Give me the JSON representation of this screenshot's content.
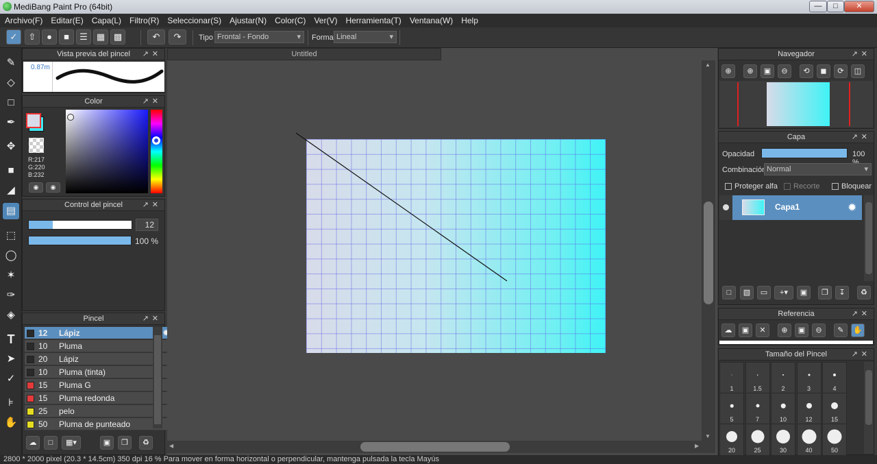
{
  "window": {
    "title": "MediBang Paint Pro (64bit)"
  },
  "menu": [
    "Archivo(F)",
    "Editar(E)",
    "Capa(L)",
    "Filtro(R)",
    "Seleccionar(S)",
    "Ajustar(N)",
    "Color(C)",
    "Ver(V)",
    "Herramienta(T)",
    "Ventana(W)",
    "Help"
  ],
  "toolbar": {
    "tipo_label": "Tipo",
    "tipo_value": "Frontal - Fondo",
    "forma_label": "Forma",
    "forma_value": "Lineal"
  },
  "brush_preview": {
    "title": "Vista previa del pincel",
    "size": "0.87m"
  },
  "color_panel": {
    "title": "Color",
    "r": "R:217",
    "g": "G:220",
    "b": "B:232",
    "fg": "#d9dce8",
    "bg": "#40e8f0"
  },
  "brush_control": {
    "title": "Control del pincel",
    "size": "12",
    "opacity": "100 %"
  },
  "brush_panel": {
    "title": "Pincel",
    "items": [
      {
        "size": "12",
        "name": "Lápiz",
        "color": "#2a2a2a",
        "selected": true
      },
      {
        "size": "10",
        "name": "Pluma",
        "color": "#2a2a2a"
      },
      {
        "size": "20",
        "name": "Lápiz",
        "color": "#2a2a2a"
      },
      {
        "size": "10",
        "name": "Pluma (tinta)",
        "color": "#2a2a2a"
      },
      {
        "size": "15",
        "name": "Pluma G",
        "color": "#e33b3b"
      },
      {
        "size": "15",
        "name": "Pluma redonda",
        "color": "#e33b3b"
      },
      {
        "size": "25",
        "name": "pelo",
        "color": "#e6dd22"
      },
      {
        "size": "50",
        "name": "Pluma de punteado",
        "color": "#e6dd22"
      }
    ]
  },
  "document": {
    "tab": "Untitled"
  },
  "navigator": {
    "title": "Navegador"
  },
  "layer_panel": {
    "title": "Capa",
    "opacity_label": "Opacidad",
    "opacity_value": "100 %",
    "blend_label": "Combinación",
    "blend_value": "Normal",
    "protect_alpha": "Proteger alfa",
    "clip": "Recorte",
    "lock": "Bloquear",
    "layer_name": "Capa1"
  },
  "reference": {
    "title": "Referencia"
  },
  "brush_size_panel": {
    "title": "Tamaño del Pincel",
    "sizes": [
      "1",
      "1.5",
      "2",
      "3",
      "4",
      "5",
      "7",
      "10",
      "12",
      "15",
      "20",
      "25",
      "30",
      "40",
      "50"
    ]
  },
  "status": {
    "text": "2800 * 2000 pixel   (20.3 * 14.5cm)   350 dpi   16 %      Para mover en forma horizontal o perpendicular, mantenga pulsada la tecla Mayús"
  }
}
